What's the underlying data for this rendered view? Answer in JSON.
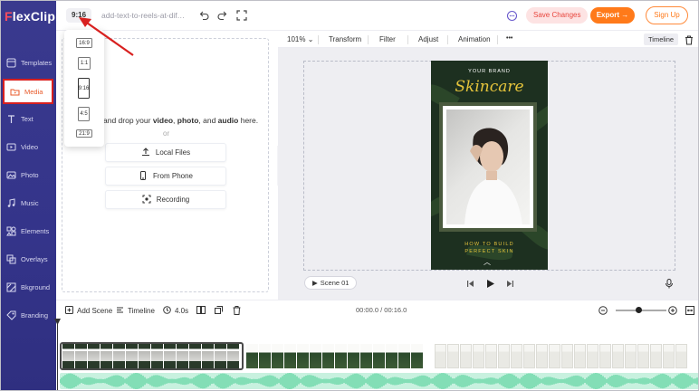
{
  "app": {
    "logo_prefix": "F",
    "logo_rest": "lexClip"
  },
  "sidebar": {
    "items": [
      {
        "label": "Templates",
        "icon": "templates-icon"
      },
      {
        "label": "Media",
        "icon": "media-folder-icon",
        "active": true
      },
      {
        "label": "Text",
        "icon": "text-icon"
      },
      {
        "label": "Video",
        "icon": "video-icon"
      },
      {
        "label": "Photo",
        "icon": "photo-icon"
      },
      {
        "label": "Music",
        "icon": "music-icon"
      },
      {
        "label": "Elements",
        "icon": "elements-icon"
      },
      {
        "label": "Overlays",
        "icon": "overlays-icon"
      },
      {
        "label": "Bkground",
        "icon": "background-icon"
      },
      {
        "label": "Branding",
        "icon": "branding-icon"
      }
    ]
  },
  "topbar": {
    "ratio": "9:16",
    "filename": "add-text-to-reels-at-diffe...",
    "save_label": "Save Changes",
    "export_label": "Export",
    "signup_label": "Sign Up"
  },
  "ratio_menu": {
    "options": [
      "16:9",
      "1:1",
      "9:16",
      "4:5",
      "21:9"
    ],
    "selected": "9:16"
  },
  "media": {
    "drop_text_parts": [
      "and drop your",
      "video",
      ",",
      "photo",
      ", and",
      "audio",
      "here."
    ],
    "or": "or",
    "buttons": [
      "Local Files",
      "From Phone",
      "Recording"
    ]
  },
  "preview_toolbar": {
    "zoom": "101%",
    "items": [
      "Transform",
      "Filter",
      "Adjust",
      "Animation"
    ],
    "more": "•••",
    "timeline_label": "Timeline"
  },
  "canvas": {
    "brand": "YOUR BRAND",
    "title": "Skincare",
    "tagline_1": "HOW TO BUILD",
    "tagline_2": "PERFECT SKIN"
  },
  "player": {
    "scene_label": "Scene 01"
  },
  "bottom_bar": {
    "add_scene": "Add Scene",
    "timeline": "Timeline",
    "duration": "4.0s",
    "time": "00:00.0 / 00:16.0"
  },
  "colors": {
    "sidebar": "#34348a",
    "accent": "#ff7a1a",
    "save_bg": "#fde3e3",
    "active_outline": "#d8201f"
  }
}
